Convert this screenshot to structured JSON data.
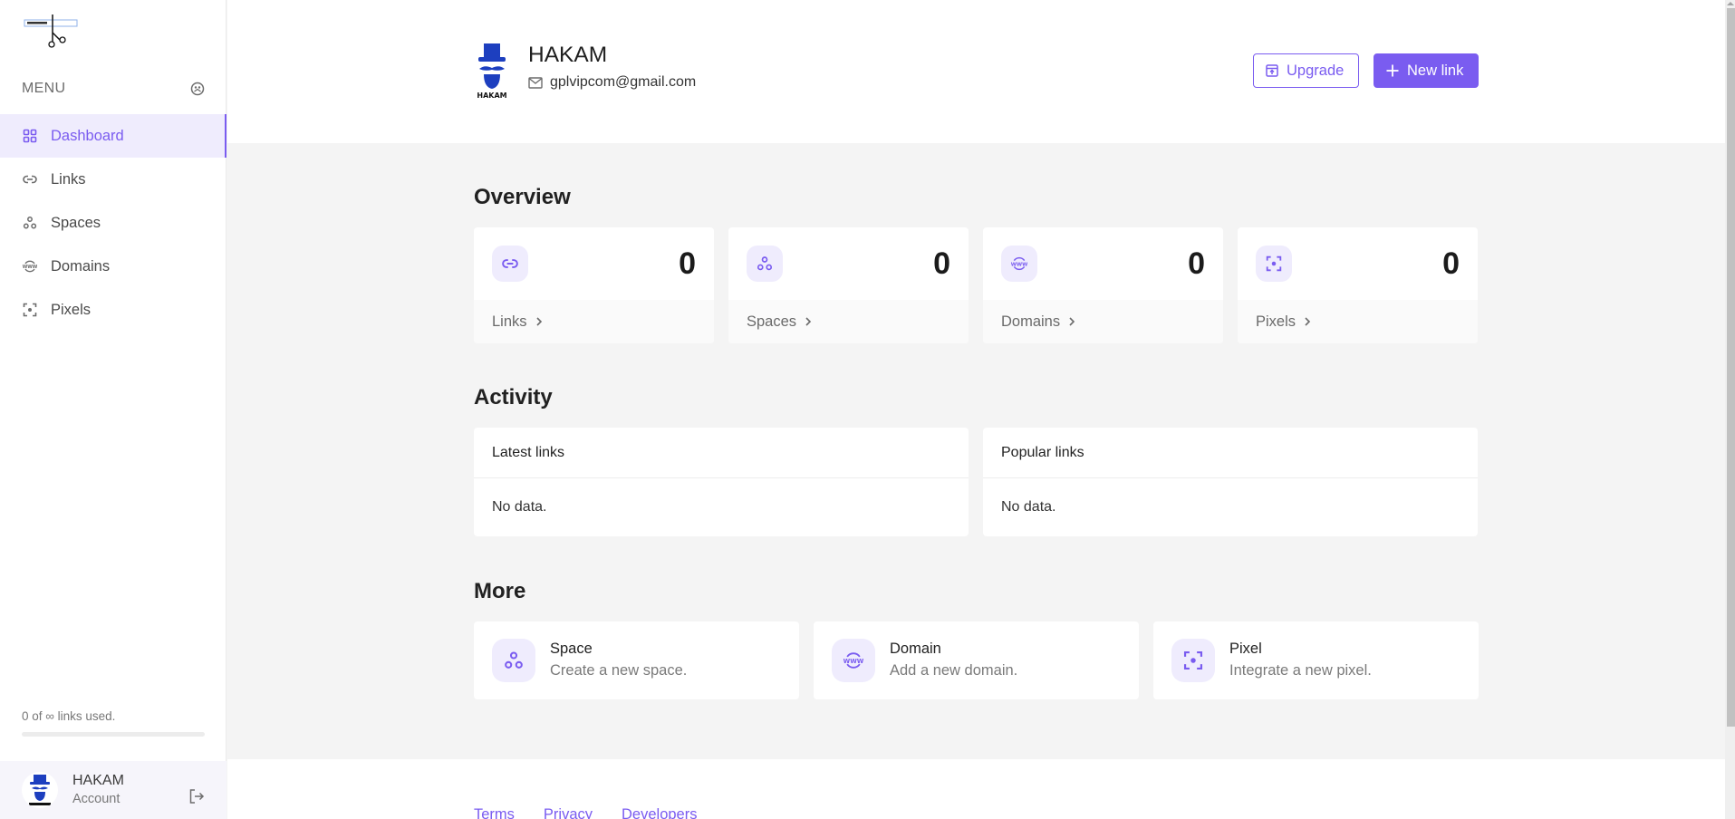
{
  "sidebar": {
    "menu_label": "MENU",
    "items": [
      {
        "label": "Dashboard",
        "icon": "grid-icon",
        "active": true
      },
      {
        "label": "Links",
        "icon": "link-icon"
      },
      {
        "label": "Spaces",
        "icon": "spaces-icon"
      },
      {
        "label": "Domains",
        "icon": "www-globe-icon"
      },
      {
        "label": "Pixels",
        "icon": "pixel-focus-icon"
      }
    ],
    "usage_text": "0 of ∞ links used.",
    "usage_fraction": 0,
    "account": {
      "name": "HAKAM",
      "sub": "Account"
    }
  },
  "header": {
    "name": "HAKAM",
    "email": "gplvipcom@gmail.com",
    "upgrade_label": "Upgrade",
    "new_link_label": "New link"
  },
  "overview": {
    "title": "Overview",
    "cards": [
      {
        "label": "Links",
        "count": "0",
        "icon": "link-icon"
      },
      {
        "label": "Spaces",
        "count": "0",
        "icon": "spaces-icon"
      },
      {
        "label": "Domains",
        "count": "0",
        "icon": "www-globe-icon"
      },
      {
        "label": "Pixels",
        "count": "0",
        "icon": "pixel-focus-icon"
      }
    ]
  },
  "activity": {
    "title": "Activity",
    "panels": [
      {
        "title": "Latest links",
        "empty": "No data."
      },
      {
        "title": "Popular links",
        "empty": "No data."
      }
    ]
  },
  "more": {
    "title": "More",
    "cards": [
      {
        "title": "Space",
        "subtitle": "Create a new space.",
        "icon": "spaces-icon"
      },
      {
        "title": "Domain",
        "subtitle": "Add a new domain.",
        "icon": "www-globe-icon"
      },
      {
        "title": "Pixel",
        "subtitle": "Integrate a new pixel.",
        "icon": "pixel-focus-icon"
      }
    ]
  },
  "footer": {
    "links": [
      "Terms",
      "Privacy",
      "Developers"
    ]
  },
  "colors": {
    "accent": "#7a5cf0",
    "accent_soft": "#efecfd",
    "page_bg": "#f4f4f4"
  }
}
